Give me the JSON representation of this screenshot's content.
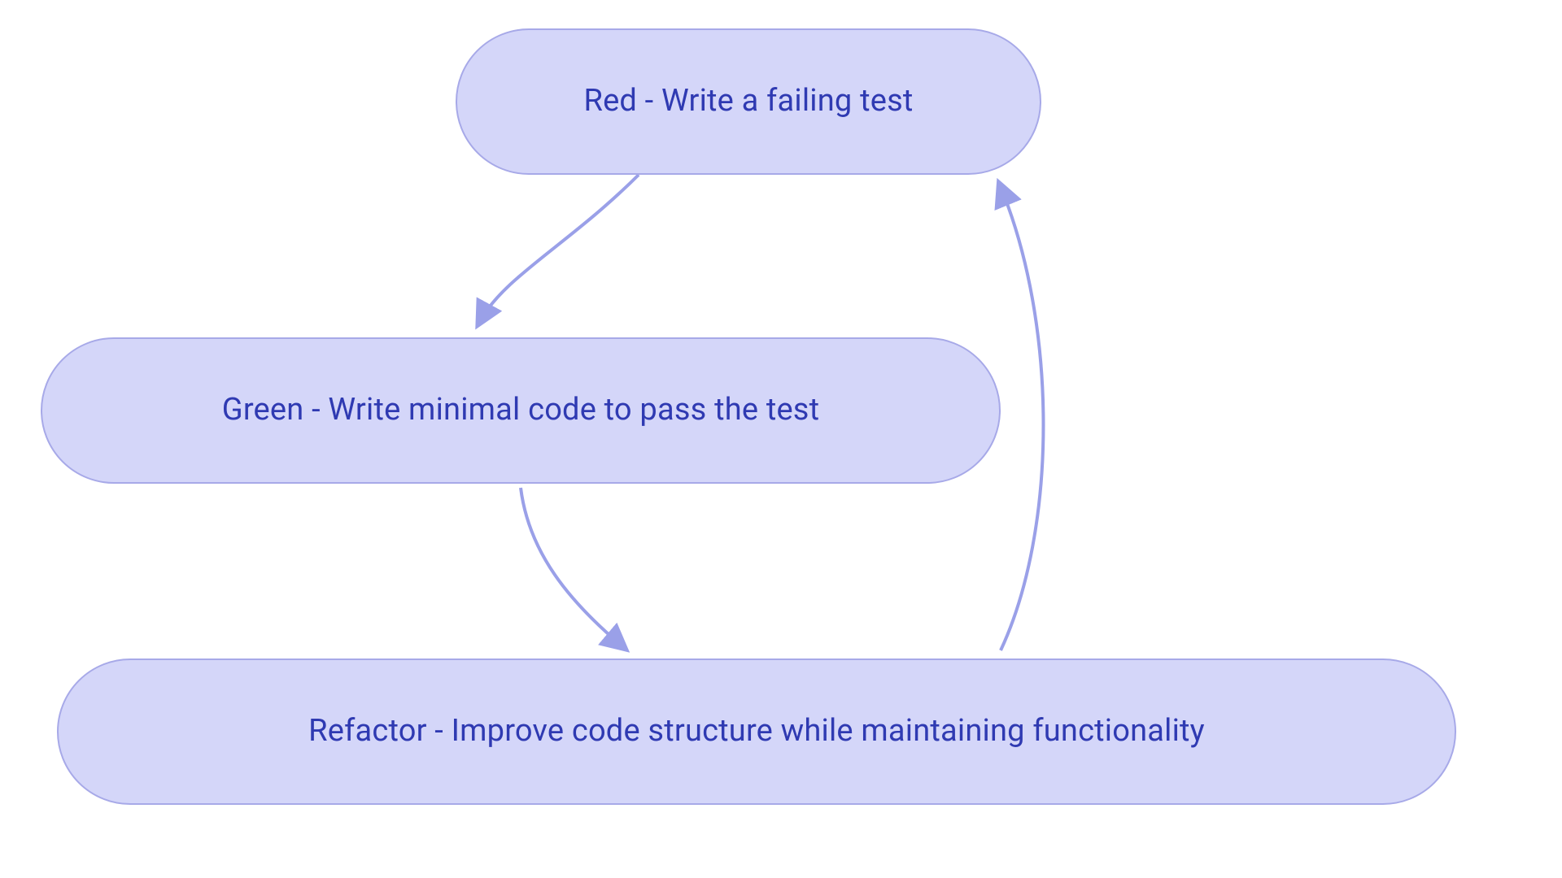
{
  "diagram": {
    "type": "tdd-cycle-flowchart",
    "nodes": {
      "red": {
        "label": "Red - Write a failing test"
      },
      "green": {
        "label": "Green - Write minimal code to pass the test"
      },
      "refactor": {
        "label": "Refactor - Improve code structure while maintaining functionality"
      }
    },
    "edges": [
      {
        "from": "red",
        "to": "green"
      },
      {
        "from": "green",
        "to": "refactor"
      },
      {
        "from": "refactor",
        "to": "red"
      }
    ],
    "style": {
      "node_fill": "#d4d6f9",
      "node_stroke": "#a7a9e8",
      "text_color": "#2f3ab2",
      "edge_color": "#9aa0e8"
    }
  }
}
